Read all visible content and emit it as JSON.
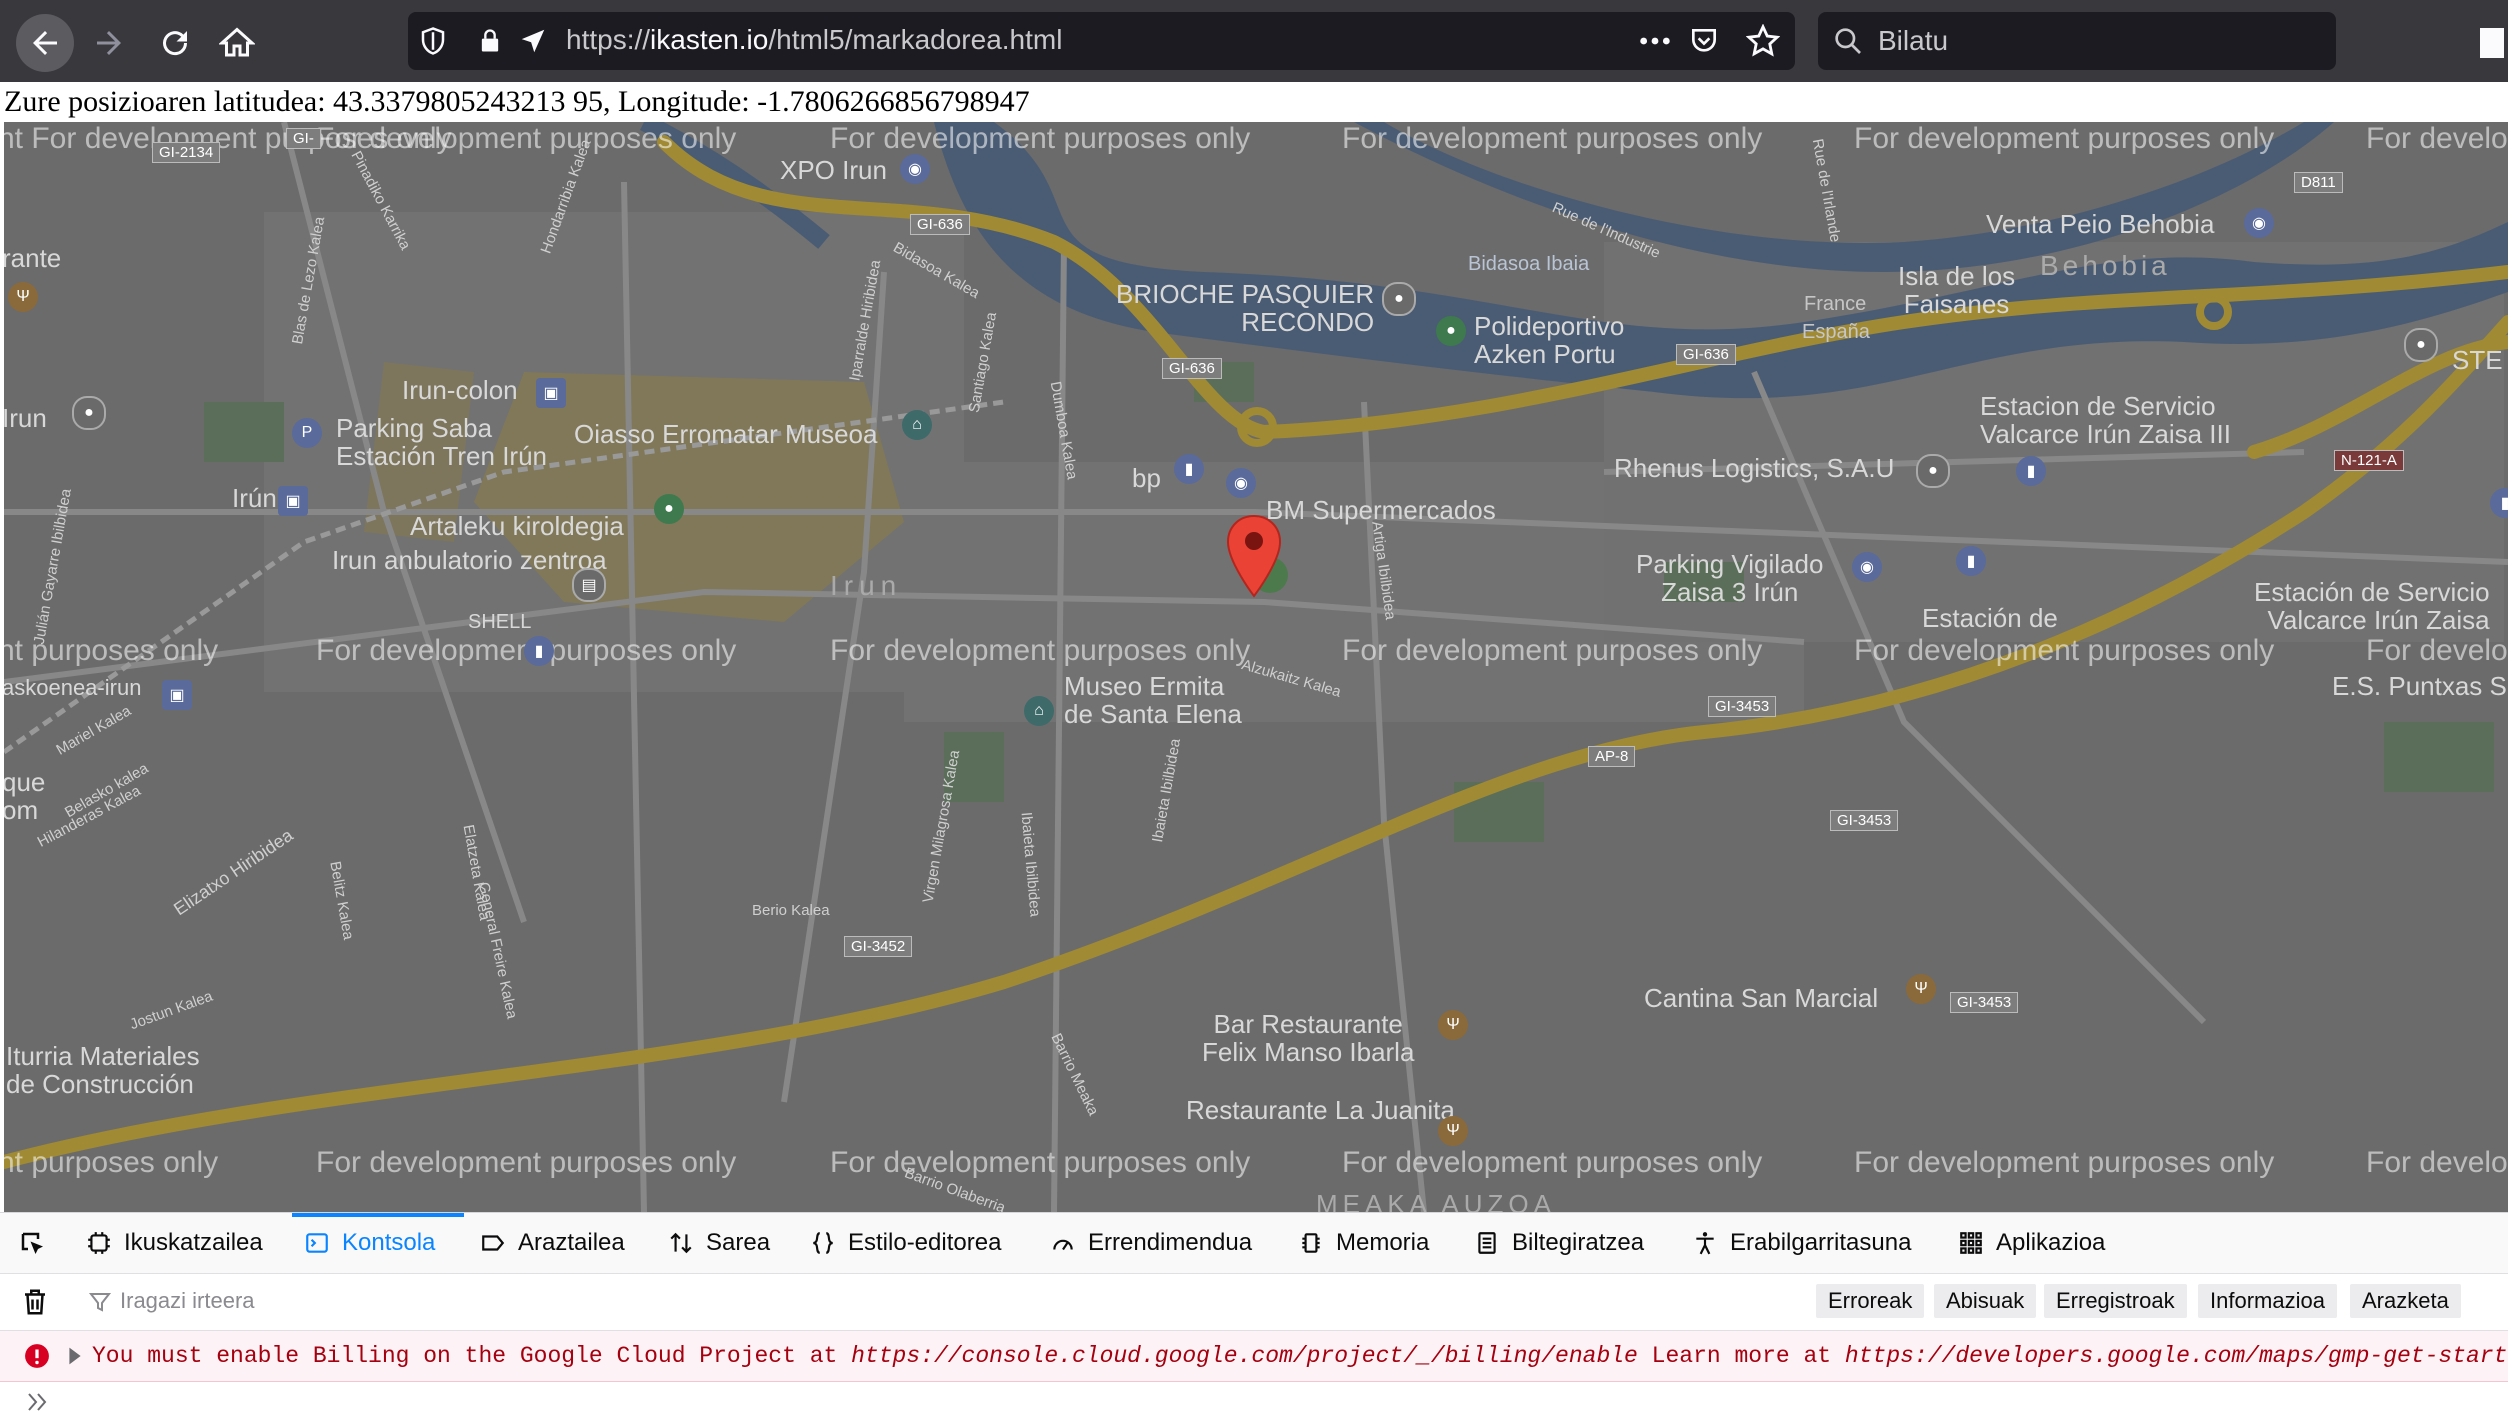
{
  "toolbar": {
    "url_prefix": "https://",
    "url_host": "ikasten.io",
    "url_path": "/html5/markadorea.html",
    "search_placeholder": "Bilatu"
  },
  "page": {
    "coords_text": "Zure posizioaren latitudea: 43.3379805243213 95, Longitude: -1.7806266856798947"
  },
  "map": {
    "watermark": "For development purposes only",
    "places": {
      "xpo_irun": "XPO Irun",
      "brioche": "BRIOCHE PASQUIER\nRECONDO",
      "polideportivo": "Polideportivo\nAzken Portu",
      "venta_peio": "Venta Peio Behobia",
      "isla": "Isla de los\nFaisanes",
      "behobia": "Behobia",
      "irun_colon": "Irun-colon",
      "parking_saba": "Parking Saba\nEstación Tren Irún",
      "oiasso": "Oiasso Erromatar Museoa",
      "bp": "bp",
      "bm": "BM Supermercados",
      "estacion_valcarce": "Estacion de Servicio\nValcarce Irún Zaisa III",
      "rhenus": "Rhenus Logistics, S.A.U",
      "irun_station": "Irún",
      "artaleku": "Artaleku kiroldegia",
      "ambulatorio": "Irun anbulatorio zentroa",
      "irun_city": "Irun",
      "parking_vigilado": "Parking Vigilado\nZaisa 3 Irún",
      "estacion_de": "Estación de",
      "estacion_servicio2": "Estación de Servicio\nValcarce Irún Zaisa",
      "museo": "Museo Ermita\nde Santa Elena",
      "es_puntxas": "E.S. Puntxas S",
      "bar_restaurante": "Bar Restaurante\nFelix Manso Ibarla",
      "cantina": "Cantina San Marcial",
      "restaurante_juanita": "Restaurante La Juanita",
      "iturria": "Iturria Materiales\nde Construcción",
      "meaka": "MEAKA AUZOA",
      "france": "France",
      "espana": "España",
      "bidasoa": "Bidasoa Ibaia",
      "irun_left": "Irun",
      "rante": "rante",
      "askoenea": "askoenea-irun",
      "que_om": "que\nom",
      "ste": "STE",
      "shell": "SHELL"
    },
    "streets": {
      "pinadiko": "Pinadiko Karrika",
      "hondarribia": "Hondarribia Kalea",
      "blas": "Blas de Lezo Kalea",
      "bidasoa_kalea": "Bidasoa Kalea",
      "iparralde": "Iparralde Hiribidea",
      "santiago": "Santiago Kalea",
      "dumboa": "Dumboa Kalea",
      "rue_industrie": "Rue de l'Industrie",
      "rue_irlande": "Rue de l'Irlande",
      "artiga": "Artiga Ibilbidea",
      "alzukaitz": "Alzukaitz Kalea",
      "julian": "Julián Gayarre Ibilbidea",
      "mariel": "Mariel Kalea",
      "belasko": "Belasko kalea",
      "hilanderas": "Hilanderas Kalea",
      "elizatxo": "Elizatxo Hiribidea",
      "belitz": "Belitz Kalea",
      "elatzeta": "Elatzeta Kalea",
      "general": "General Freire Kalea",
      "virgen": "Virgen Milagrosa Kalea",
      "ibaieta_ibilbidea": "Ibaieta Ibilbidea",
      "ibaieta_ibilbidea2": "Ibaieta Ibilbidea",
      "berio": "Berio Kalea",
      "jostun": "Jostun Kalea",
      "barrio": "Barrio Meaka",
      "olaberria": "Barrio Olaberria"
    },
    "shields": {
      "gi2134": "GI-2134",
      "gi636a": "GI-636",
      "gi636b": "GI-636",
      "gi636c": "GI-636",
      "d811": "D811",
      "n121a": "N-121-A",
      "gi3453a": "GI-3453",
      "gi3453b": "GI-3453",
      "gi3453c": "GI-3453",
      "ap8": "AP-8",
      "gi3452": "GI-3452",
      "gi_left": "GI-"
    }
  },
  "devtools": {
    "tabs": [
      {
        "label": "Ikuskatzailea",
        "icon": "inspector-icon"
      },
      {
        "label": "Kontsola",
        "icon": "console-icon"
      },
      {
        "label": "Araztailea",
        "icon": "debugger-icon"
      },
      {
        "label": "Sarea",
        "icon": "network-icon"
      },
      {
        "label": "Estilo-editorea",
        "icon": "style-editor-icon"
      },
      {
        "label": "Errendimendua",
        "icon": "performance-icon"
      },
      {
        "label": "Memoria",
        "icon": "memory-icon"
      },
      {
        "label": "Biltegiratzea",
        "icon": "storage-icon"
      },
      {
        "label": "Erabilgarritasuna",
        "icon": "accessibility-icon"
      },
      {
        "label": "Aplikazioa",
        "icon": "application-icon"
      }
    ],
    "active_tab": "Kontsola",
    "filter_placeholder": "Iragazi irteera",
    "filter_buttons": [
      "Erroreak",
      "Abisuak",
      "Erregistroak",
      "Informazioa",
      "Arazketa"
    ],
    "error": {
      "text": "You must enable Billing on the Google Cloud Project at ",
      "link1": "https://console.cloud.google.com/project/_/billing/enable",
      "mid": " Learn more at ",
      "link2": "https://developers.google.com/maps/gmp-get-started"
    }
  },
  "colors": {
    "toolbar_bg": "#38383d",
    "devtools_accent": "#0a84ff",
    "error_text": "#a4000f",
    "map_overlay": "#6a6a6a"
  }
}
